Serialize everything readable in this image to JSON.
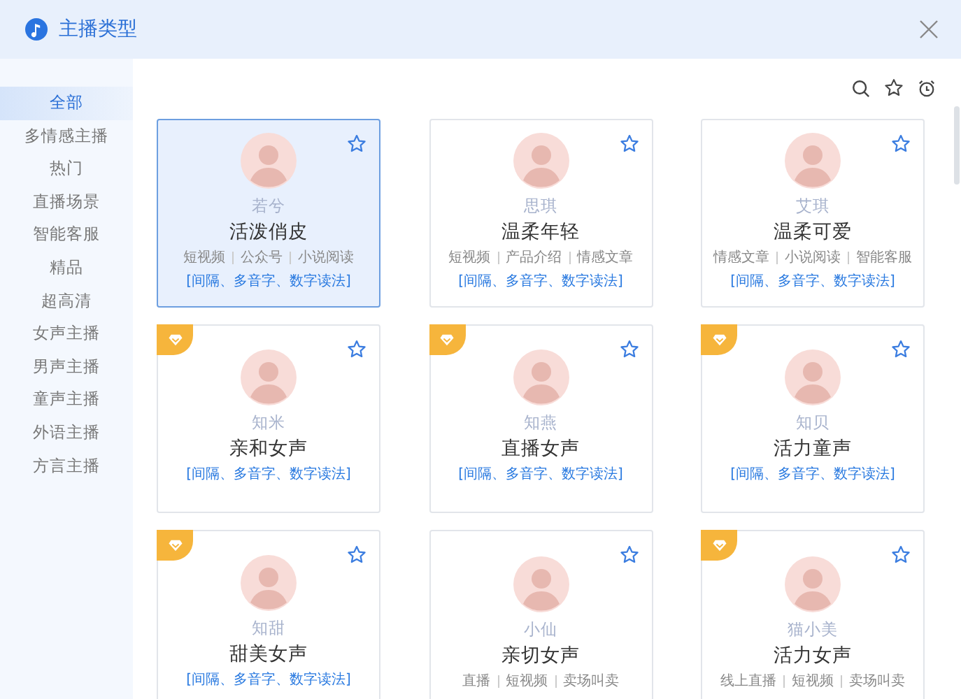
{
  "window": {
    "title": "主播类型"
  },
  "sidebar": {
    "items": [
      {
        "label": "全部",
        "selected": true
      },
      {
        "label": "多情感主播",
        "selected": false
      },
      {
        "label": "热门",
        "selected": false
      },
      {
        "label": "直播场景",
        "selected": false
      },
      {
        "label": "智能客服",
        "selected": false
      },
      {
        "label": "精品",
        "selected": false
      },
      {
        "label": "超高清",
        "selected": false
      },
      {
        "label": "女声主播",
        "selected": false
      },
      {
        "label": "男声主播",
        "selected": false
      },
      {
        "label": "童声主播",
        "selected": false
      },
      {
        "label": "外语主播",
        "selected": false
      },
      {
        "label": "方言主播",
        "selected": false
      }
    ]
  },
  "anchors": [
    {
      "name": "若兮",
      "style": "活泼俏皮",
      "tags": [
        "短视频",
        "公众号",
        "小说阅读"
      ],
      "features": "[间隔、多音字、数字读法]",
      "selected": true,
      "vip": false
    },
    {
      "name": "思琪",
      "style": "温柔年轻",
      "tags": [
        "短视频",
        "产品介绍",
        "情感文章"
      ],
      "features": "[间隔、多音字、数字读法]",
      "selected": false,
      "vip": false
    },
    {
      "name": "艾琪",
      "style": "温柔可爱",
      "tags": [
        "情感文章",
        "小说阅读",
        "智能客服"
      ],
      "features": "[间隔、多音字、数字读法]",
      "selected": false,
      "vip": false
    },
    {
      "name": "知米",
      "style": "亲和女声",
      "features": "[间隔、多音字、数字读法]",
      "selected": false,
      "vip": true
    },
    {
      "name": "知燕",
      "style": "直播女声",
      "features": "[间隔、多音字、数字读法]",
      "selected": false,
      "vip": true
    },
    {
      "name": "知贝",
      "style": "活力童声",
      "features": "[间隔、多音字、数字读法]",
      "selected": false,
      "vip": true
    },
    {
      "name": "知甜",
      "style": "甜美女声",
      "features": "[间隔、多音字、数字读法]",
      "selected": false,
      "vip": true
    },
    {
      "name": "小仙",
      "style": "亲切女声",
      "tags": [
        "直播",
        "短视频",
        "卖场叫卖"
      ],
      "selected": false,
      "vip": false
    },
    {
      "name": "猫小美",
      "style": "活力女声",
      "tags": [
        "线上直播",
        "短视频",
        "卖场叫卖"
      ],
      "selected": false,
      "vip": true
    }
  ]
}
